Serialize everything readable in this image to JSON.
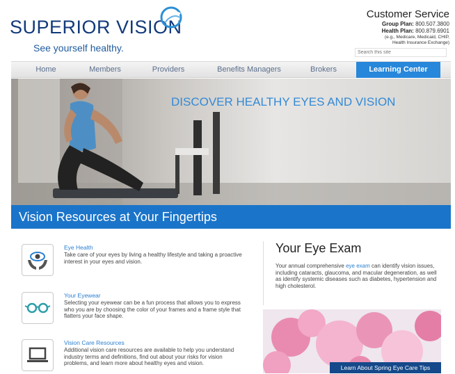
{
  "header": {
    "logo": "SUPERIOR VISION",
    "tagline": "See yourself healthy.",
    "customer_service": {
      "title": "Customer Service",
      "group_label": "Group Plan:",
      "group_phone": "800.507.3800",
      "health_label": "Health Plan:",
      "health_phone": "800.879.6901",
      "note_line1": "(e.g., Medicare, Medicaid, CHIP,",
      "note_line2": "Health Insurance Exchange)"
    },
    "search_placeholder": "Search this site"
  },
  "nav": {
    "items": [
      "Home",
      "Members",
      "Providers",
      "Benefits Managers",
      "Brokers",
      "Learning Center"
    ],
    "active": "Learning Center"
  },
  "hero": {
    "title": "DISCOVER HEALTHY EYES AND VISION"
  },
  "banner": {
    "title": "Vision Resources at Your Fingertips"
  },
  "resources": [
    {
      "title": "Eye Health",
      "icon": "eye-in-hands-icon",
      "desc": "Take care of your eyes by living a healthy lifestyle and taking a proactive interest in your eyes and vision."
    },
    {
      "title": "Your Eyewear",
      "icon": "eyeglasses-icon",
      "desc": "Selecting your eyewear can be a fun process that allows you to express who you are by choosing the color of your frames and a frame style that flatters your face shape."
    },
    {
      "title": "Vision Care Resources",
      "icon": "laptop-icon",
      "desc": "Additional vision care resources are available to help you understand industry terms and definitions, find out about your risks for vision problems, and learn more about healthy eyes and vision."
    }
  ],
  "exam": {
    "title": "Your Eye Exam",
    "desc_before": "Your annual comprehensive ",
    "link": "eye exam",
    "desc_after": " can identify vision issues, including cataracts, glaucoma, and macular degeneration, as well as identify systemic diseases such as diabetes, hypertension and high cholesterol."
  },
  "spring": {
    "button": "Learn About Spring Eye Care Tips"
  },
  "colors": {
    "brand_navy": "#123a7a",
    "accent_blue": "#1a74c9",
    "link_blue": "#2b7fd0",
    "nav_active": "#2787db"
  }
}
